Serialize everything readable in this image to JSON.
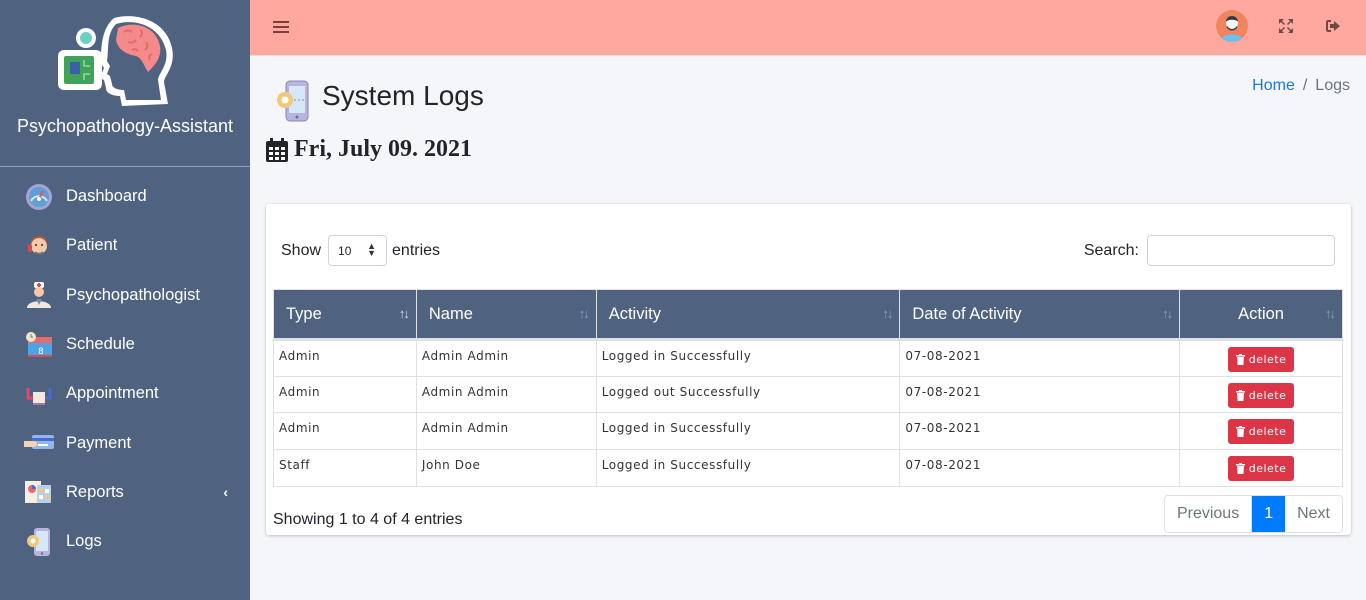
{
  "app": {
    "name": "Psychopathology-Assistant"
  },
  "sidebar": {
    "items": [
      {
        "label": "Dashboard",
        "icon": "speedometer-icon"
      },
      {
        "label": "Patient",
        "icon": "patient-icon"
      },
      {
        "label": "Psychopathologist",
        "icon": "doctor-icon"
      },
      {
        "label": "Schedule",
        "icon": "calendar-clock-icon"
      },
      {
        "label": "Appointment",
        "icon": "appointment-icon"
      },
      {
        "label": "Payment",
        "icon": "credit-card-icon"
      },
      {
        "label": "Reports",
        "icon": "report-icon",
        "has_submenu": true,
        "caret": "‹"
      },
      {
        "label": "Logs",
        "icon": "phone-gear-icon"
      }
    ]
  },
  "topbar": {
    "menu_icon": "hamburger-icon",
    "avatar_icon": "user-avatar-icon",
    "fullscreen_icon": "expand-icon",
    "logout_icon": "sign-out-icon"
  },
  "header": {
    "title": "System Logs",
    "date": "Fri, July 09. 2021",
    "breadcrumb": {
      "home": "Home",
      "separator": "/",
      "current": "Logs"
    }
  },
  "table_controls": {
    "show_label": "Show",
    "entries_label": "entries",
    "page_length": "10",
    "search_label": "Search:",
    "search_value": ""
  },
  "table": {
    "columns": [
      "Type",
      "Name",
      "Activity",
      "Date of Activity",
      "Action"
    ],
    "rows": [
      {
        "type": "Admin",
        "name": "Admin Admin",
        "activity": "Logged in Successfully",
        "date": "07-08-2021",
        "action": "delete"
      },
      {
        "type": "Admin",
        "name": "Admin Admin",
        "activity": "Logged out Successfully",
        "date": "07-08-2021",
        "action": "delete"
      },
      {
        "type": "Admin",
        "name": "Admin Admin",
        "activity": "Logged in Successfully",
        "date": "07-08-2021",
        "action": "delete"
      },
      {
        "type": "Staff",
        "name": "John Doe",
        "activity": "Logged in Successfully",
        "date": "07-08-2021",
        "action": "delete"
      }
    ]
  },
  "footer": {
    "info": "Showing 1 to 4 of 4 entries",
    "pagination": {
      "previous": "Previous",
      "current_page": "1",
      "next": "Next"
    }
  },
  "colors": {
    "sidebar_bg": "#4f6380",
    "topbar_bg": "#ffa8a0",
    "table_header_bg": "#4f6380",
    "delete_button": "#dc3545",
    "active_page": "#007bff",
    "link": "#1a7ad4"
  }
}
